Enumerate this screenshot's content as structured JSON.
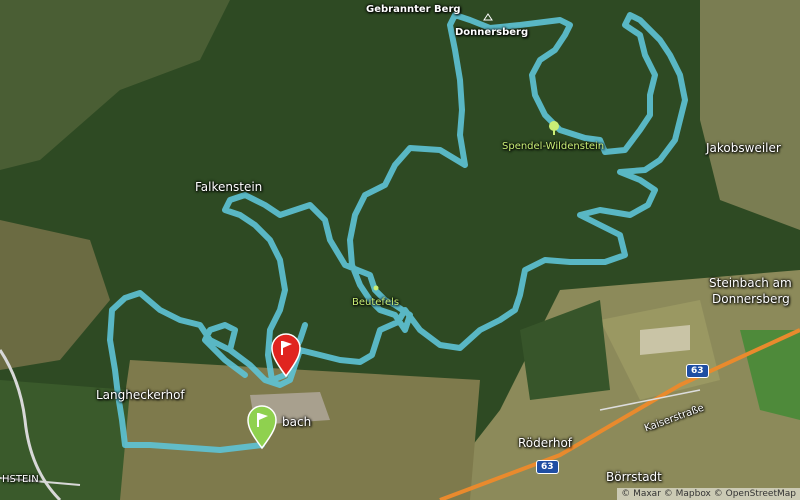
{
  "map": {
    "colors": {
      "route": "#5ec3d6",
      "forest": "#2f4a24",
      "field": "#8a8a55",
      "highway": "#e98a2d",
      "start_pin": "#8fd14f",
      "end_pin": "#e0241f"
    },
    "labels": {
      "gebrannter_berg": "Gebrannter Berg",
      "donnersberg": "Donnersberg",
      "spendel_wildenstein": "Spendel-Wildenstein",
      "jakobsweiler": "Jakobsweiler",
      "falkenstein": "Falkenstein",
      "steinbach_line1": "Steinbach am",
      "steinbach_line2": "Donnersberg",
      "beutefels": "Beutefels",
      "langheckerhof": "Langheckerhof",
      "bach": "bach",
      "roederhof": "Röderhof",
      "kaiserstrasse": "Kaiserstraße",
      "boerrstadt": "Börrstadt",
      "hstein": "HSTEIN"
    },
    "road_shields": [
      "63",
      "63"
    ],
    "attribution": "© Maxar © Mapbox © OpenStreetMap",
    "icons": [
      "summit-triangle-icon",
      "tree-icon",
      "start-flag-pin-icon",
      "finish-flag-pin-icon"
    ]
  }
}
